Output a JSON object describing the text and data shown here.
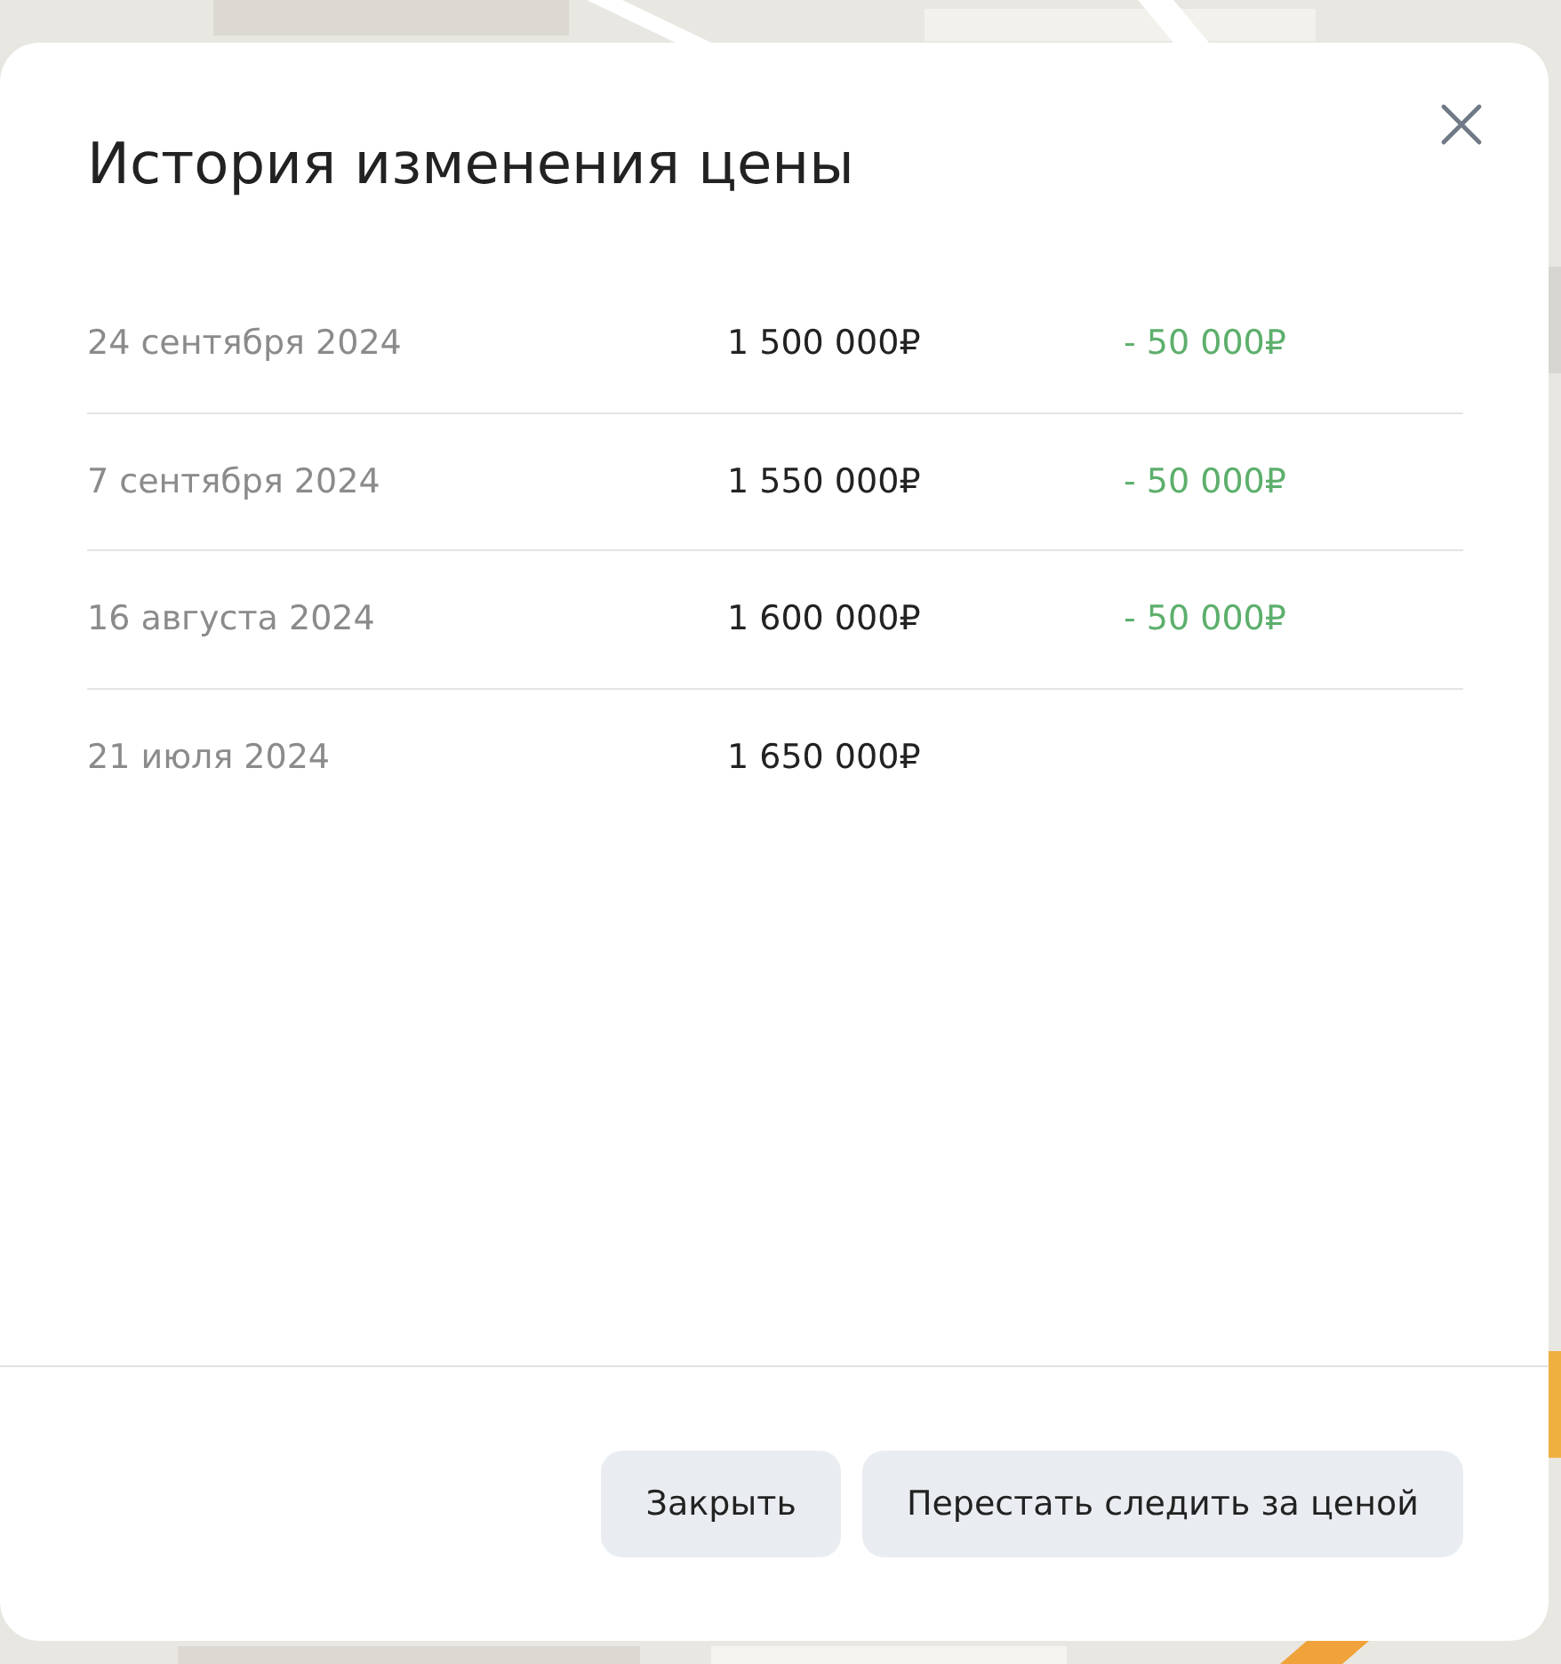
{
  "dialog": {
    "title": "История изменения цены",
    "rows": [
      {
        "date": "24 сентября 2024",
        "price": "1 500 000₽",
        "change": "- 50 000₽"
      },
      {
        "date": "7 сентября 2024",
        "price": "1 550 000₽",
        "change": "- 50 000₽"
      },
      {
        "date": "16 августа 2024",
        "price": "1 600 000₽",
        "change": "- 50 000₽"
      },
      {
        "date": "21 июля 2024",
        "price": "1 650 000₽"
      }
    ],
    "buttons": [
      "Закрыть",
      "Перестать следить за ценой"
    ]
  }
}
